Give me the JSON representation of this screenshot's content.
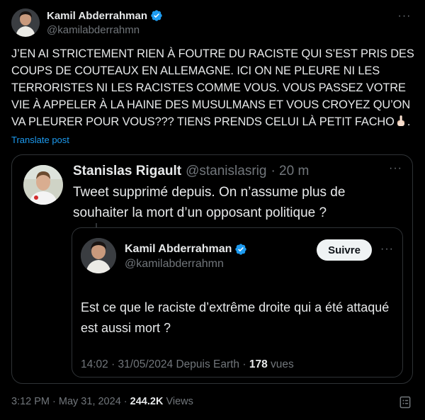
{
  "tweet": {
    "author": {
      "name": "Kamil Abderrahman",
      "handle": "@kamilabderrahmn",
      "verified": true
    },
    "more_label": "···",
    "text": "J’EN AI STRICTEMENT RIEN À FOUTRE DU RACISTE QUI S’EST PRIS DES COUPS DE COUTEAUX EN ALLEMAGNE. ICI ON NE PLEURE NI LES TERRORISTES NI LES RACISTES COMME VOUS. VOUS PASSEZ VOTRE VIE À APPELER À LA HAINE DES MUSULMANS ET VOUS CROYEZ QU’ON VA PLEURER POUR VOUS??? TIENS PRENDS CELUI LÀ PETIT FACHO",
    "text_end": ".",
    "emoji": "middle-finger-emoji",
    "translate_label": "Translate post",
    "time": "3:12 PM",
    "separator": " · ",
    "date": "May 31, 2024",
    "views_count": "244.2K",
    "views_label": " Views"
  },
  "quoted_tweet": {
    "author": {
      "name": "Stanislas Rigault",
      "handle": "@stanislasrig",
      "age": "· 20 m"
    },
    "more_label": "···",
    "text": "Tweet supprimé depuis. On n’assume plus de souhaiter la mort d’un opposant politique ?",
    "embedded": {
      "author": {
        "name": "Kamil Abderrahman",
        "handle": "@kamilabderrahmn",
        "verified": true
      },
      "follow_label": "Suivre",
      "more_label": "···",
      "text": "Est ce que le raciste d’extrême droite qui a été attaqué est aussi mort ?",
      "meta_prefix": "14:02 · 31/05/2024 Depuis Earth · ",
      "views_count": "178",
      "views_label": " vues"
    }
  },
  "colors": {
    "background": "#000000",
    "text": "#e7e9ea",
    "secondary": "#71767b",
    "link": "#1d9bf0",
    "border": "#2f3336",
    "verified": "#1d9bf0"
  },
  "icons": [
    "verified-badge-icon",
    "more-icon",
    "bookmark-icon"
  ]
}
